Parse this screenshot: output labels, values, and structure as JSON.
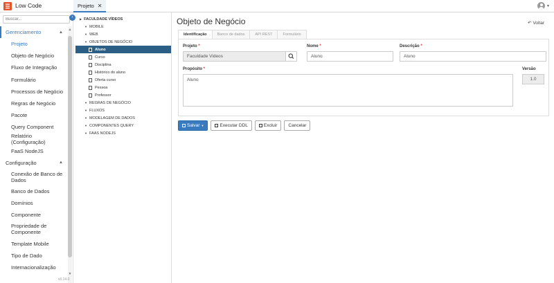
{
  "app": {
    "title": "Low Code",
    "tab_label": "Projeto",
    "tab_close": "✕"
  },
  "sidebar": {
    "search_placeholder": "Buscar...",
    "groups": [
      {
        "label": "Gerenciamento",
        "items": [
          "Projeto",
          "Objeto de Negócio",
          "Fluxo de Integração",
          "Formulário",
          "Processos de Negócio",
          "Regras de Negócio",
          "Pacote",
          "Query Component",
          "Relatório (Configuração)",
          "FaaS NodeJS"
        ]
      },
      {
        "label": "Configuração",
        "items": [
          "Conexão de Banco de Dados",
          "Banco de Dados",
          "Domínios",
          "Componente",
          "Propriedade de Componente",
          "Template Mobile",
          "Tipo de Dado",
          "Internacionalização"
        ]
      }
    ],
    "version": "v0.14.0"
  },
  "tree": {
    "root": "FACULDADE VÍDEOS",
    "nodes": {
      "mobile": "MOBILE",
      "web": "WEB",
      "objetos": "OBJETOS DE NEGÓCIO",
      "regras": "REGRAS DE NEGÓCIO",
      "fluxos": "FLUXOS",
      "modelagem": "MODELAGEM DE DADOS",
      "componentes": "COMPONENTES QUERY",
      "faas": "FAAS NODEJS"
    },
    "objects": [
      "Aluno",
      "Curso",
      "Disciplina",
      "Histórico do aluno",
      "Oferta curso",
      "Pessoa",
      "Professor"
    ]
  },
  "main": {
    "title": "Objeto de Negócio",
    "back": "Voltar",
    "tabs": [
      "Identificação",
      "Banco de dados",
      "API REST",
      "Formulário"
    ],
    "form": {
      "projeto_label": "Projeto",
      "projeto_value": "Faculdade Videos",
      "nome_label": "Nome",
      "nome_value": "Aluno",
      "descricao_label": "Descrição",
      "descricao_value": "Aluno",
      "proposito_label": "Propósito",
      "proposito_value": "Aluno",
      "versao_label": "Versão",
      "versao_value": "1.0",
      "required_mark": "*"
    },
    "buttons": {
      "save": "Salvar",
      "execute": "Executar DDL",
      "delete": "Excluir",
      "cancel": "Cancelar"
    }
  },
  "colors": {
    "accent": "#3a7bbf",
    "tree_selected": "#2c5f86",
    "logo": "#e8542a",
    "required": "#dd3333"
  },
  "icons": [
    "app-logo-icon",
    "close-icon",
    "user-icon",
    "chevron-up-icon",
    "collapse-left-icon",
    "triangle-right-icon",
    "triangle-down-icon",
    "document-icon",
    "undo-icon",
    "search-icon",
    "save-icon",
    "database-icon",
    "trash-icon",
    "caret-down-icon"
  ]
}
